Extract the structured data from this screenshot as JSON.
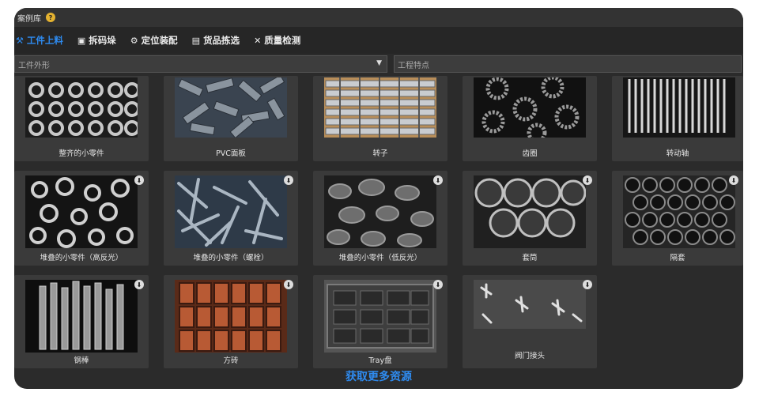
{
  "window": {
    "title": "案例库",
    "help_glyph": "?"
  },
  "tabs": [
    {
      "label": "工件上料",
      "icon": "parts-icon",
      "active": true
    },
    {
      "label": "拆码垛",
      "icon": "box-icon",
      "active": false
    },
    {
      "label": "定位装配",
      "icon": "gear-target-icon",
      "active": false
    },
    {
      "label": "货品拣选",
      "icon": "package-icon",
      "active": false
    },
    {
      "label": "质量检测",
      "icon": "inspect-icon",
      "active": false
    }
  ],
  "filters": {
    "shape_placeholder": "工件外形",
    "feature_placeholder": "工程特点"
  },
  "cards": [
    {
      "label": "整齐的小零件",
      "download": false
    },
    {
      "label": "PVC面板",
      "download": false
    },
    {
      "label": "转子",
      "download": false
    },
    {
      "label": "齿圈",
      "download": false
    },
    {
      "label": "转动轴",
      "download": false
    },
    {
      "label": "堆叠的小零件（高反光）",
      "download": true
    },
    {
      "label": "堆叠的小零件（螺栓）",
      "download": true
    },
    {
      "label": "堆叠的小零件（低反光）",
      "download": true
    },
    {
      "label": "套筒",
      "download": true
    },
    {
      "label": "隔套",
      "download": true
    },
    {
      "label": "钢棒",
      "download": true
    },
    {
      "label": "方砖",
      "download": true
    },
    {
      "label": "Tray盘",
      "download": true
    },
    {
      "label": "阀门接头",
      "download": true
    }
  ],
  "footer": {
    "more_link": "获取更多资源"
  },
  "colors": {
    "accent": "#2e8bf0",
    "bg": "#2b2b2b",
    "card": "#3a3a3a"
  }
}
